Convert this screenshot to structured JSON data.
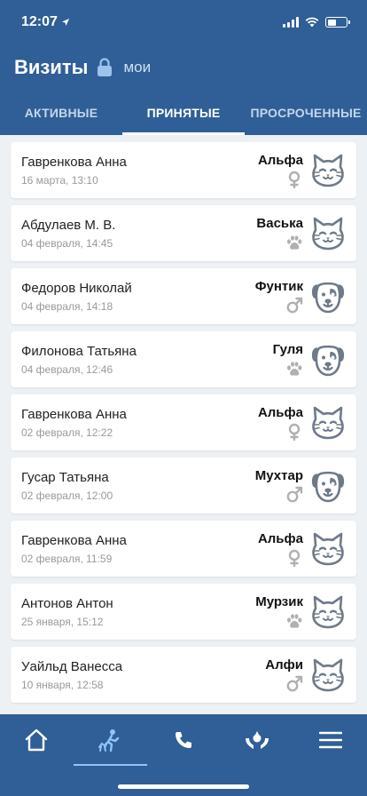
{
  "status_bar": {
    "time": "12:07"
  },
  "header": {
    "title": "Визиты",
    "filter_label": "мои"
  },
  "tabs": [
    {
      "label": "АКТИВНЫЕ",
      "active": false
    },
    {
      "label": "ПРИНЯТЫЕ",
      "active": true
    },
    {
      "label": "ПРОСРОЧЕННЫЕ",
      "active": false
    }
  ],
  "visits": [
    {
      "owner": "Гавренкова Анна",
      "date": "16 марта, 13:10",
      "pet": "Альфа",
      "sex": "female",
      "species": "cat"
    },
    {
      "owner": "Абдулаев М. В.",
      "date": "04 февраля, 14:45",
      "pet": "Васька",
      "sex": "unknown",
      "species": "cat"
    },
    {
      "owner": "Федоров Николай",
      "date": "04 февраля, 14:18",
      "pet": "Фунтик",
      "sex": "male",
      "species": "dog"
    },
    {
      "owner": "Филонова Татьяна",
      "date": "04 февраля, 12:46",
      "pet": "Гуля",
      "sex": "unknown",
      "species": "dog"
    },
    {
      "owner": "Гавренкова Анна",
      "date": "02 февраля, 12:22",
      "pet": "Альфа",
      "sex": "female",
      "species": "cat"
    },
    {
      "owner": "Гусар Татьяна",
      "date": "02 февраля, 12:00",
      "pet": "Мухтар",
      "sex": "male",
      "species": "dog"
    },
    {
      "owner": "Гавренкова Анна",
      "date": "02 февраля, 11:59",
      "pet": "Альфа",
      "sex": "female",
      "species": "cat"
    },
    {
      "owner": "Антонов Антон",
      "date": "25 января, 15:12",
      "pet": "Мурзик",
      "sex": "unknown",
      "species": "cat"
    },
    {
      "owner": "Уайльд Ванесса",
      "date": "10 января, 12:58",
      "pet": "Алфи",
      "sex": "male",
      "species": "cat"
    }
  ],
  "bottom_nav": [
    {
      "icon": "home-icon",
      "active": false
    },
    {
      "icon": "visits-icon",
      "active": true
    },
    {
      "icon": "phone-icon",
      "active": false
    },
    {
      "icon": "pet-care-icon",
      "active": false
    },
    {
      "icon": "menu-icon",
      "active": false
    }
  ],
  "colors": {
    "primary": "#2f5f96",
    "icon_gray": "#6e7a88",
    "sex_gray": "#b0b0b0",
    "active_underline": "#8fc4ff"
  }
}
